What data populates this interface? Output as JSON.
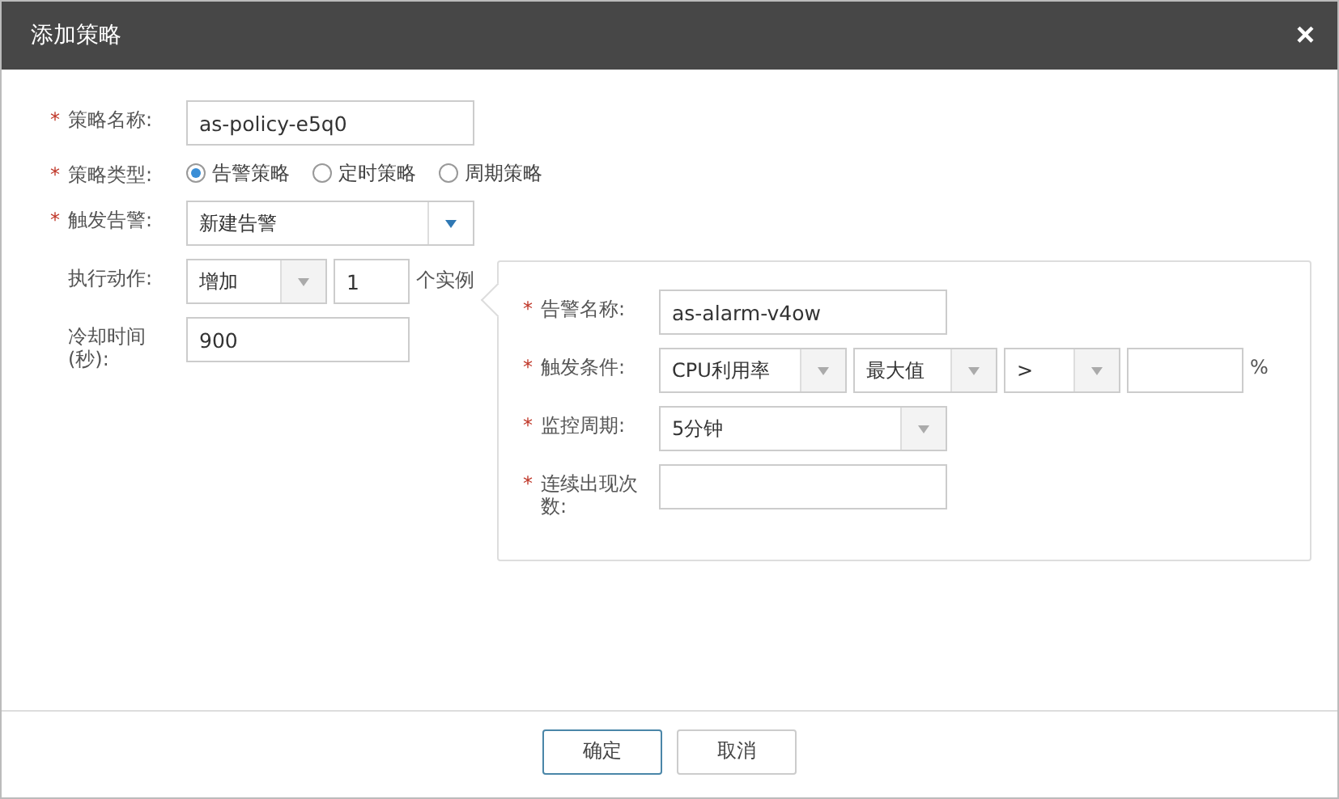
{
  "dialog": {
    "title": "添加策略",
    "close": "×"
  },
  "fields": [
    {
      "kind": "text",
      "label": "策略名称:",
      "mark": "*",
      "value": "as-policy-e5q0"
    },
    {
      "kind": "radio",
      "label": "策略类型:",
      "mark": "*",
      "options": [
        {
          "label": "告警策略",
          "selected": true
        },
        {
          "label": "定时策略",
          "selected": false
        },
        {
          "label": "周期策略",
          "selected": false
        }
      ]
    },
    {
      "kind": "combo",
      "label": "触发告警:",
      "mark": "*",
      "value": "新建告警"
    },
    {
      "kind": "action",
      "label": "执行动作:",
      "value": "增加",
      "count": "1",
      "unit": "个实例"
    },
    {
      "kind": "short",
      "label": "冷却时间(秒):",
      "value": "900"
    }
  ],
  "alarm": {
    "fields": [
      {
        "kind": "text",
        "label": "告警名称:",
        "mark": "*",
        "value": "as-alarm-v4ow"
      },
      {
        "kind": "condition",
        "label": "触发条件:",
        "mark": "*",
        "selects": [
          "CPU利用率",
          "最大值",
          ">"
        ],
        "unit": "%"
      },
      {
        "kind": "select",
        "label": "监控周期:",
        "mark": "*",
        "value": "5分钟"
      },
      {
        "kind": "text",
        "label": "连续出现次数:",
        "mark": "*"
      }
    ]
  },
  "buttons": [
    {
      "label": "确定",
      "primary": true
    },
    {
      "label": "取消",
      "primary": false
    }
  ]
}
